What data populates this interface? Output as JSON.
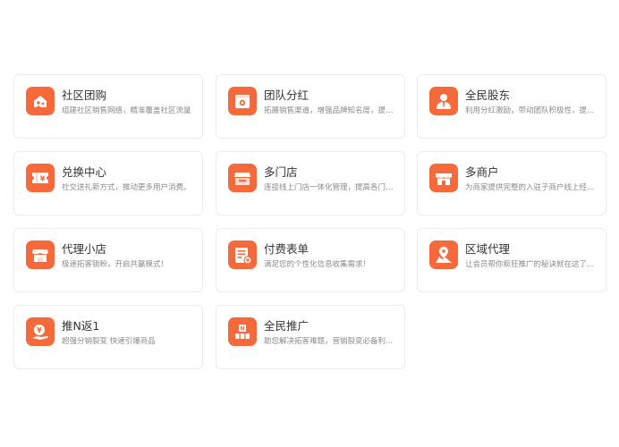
{
  "colors": {
    "accent": "#f5693b",
    "title_text": "#333333",
    "desc_text": "#8a8a8a",
    "card_border": "#ececec"
  },
  "cards": [
    {
      "icon": "community-house-icon",
      "title": "社区团购",
      "desc": "组建社区销售网络，精准覆盖社区流量"
    },
    {
      "icon": "team-dividend-icon",
      "title": "团队分红",
      "desc": "拓展销售渠道，增强品牌知名度，提升..."
    },
    {
      "icon": "shareholder-person-icon",
      "title": "全民股东",
      "desc": "利用分红激励，带动团队积极性，提升..."
    },
    {
      "icon": "voucher-exchange-icon",
      "title": "兑换中心",
      "desc": "社交送礼新方式，推动更多用户消费。"
    },
    {
      "icon": "multi-store-icon",
      "title": "多门店",
      "desc": "连接线上门店一体化管理，提高各门店..."
    },
    {
      "icon": "multi-merchant-icon",
      "title": "多商户",
      "desc": "为商家提供完整的入驻子商户线上经营..."
    },
    {
      "icon": "agent-shop-icon",
      "title": "代理小店",
      "desc": "极速拓客锁粉，开启共赢模式！"
    },
    {
      "icon": "paid-form-icon",
      "title": "付费表单",
      "desc": "满足您的个性化信息收集需求！"
    },
    {
      "icon": "region-location-icon",
      "title": "区域代理",
      "desc": "让会员帮你疯狂推广的秘诀就在这了！..."
    },
    {
      "icon": "referral-cashback-icon",
      "title": "推N返1",
      "desc": "超强分销裂变 快速引爆商品"
    },
    {
      "icon": "promotion-blocks-icon",
      "title": "全民推广",
      "desc": "助您解决拓客难题，营销裂变必备利..."
    }
  ]
}
